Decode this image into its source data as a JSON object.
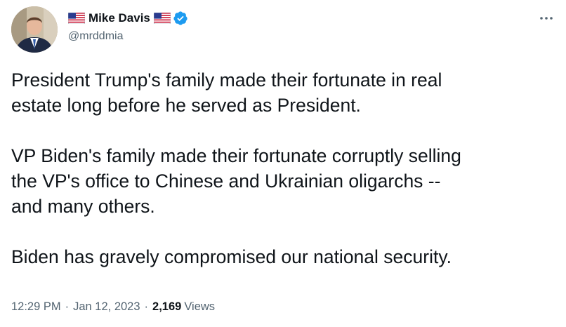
{
  "author": {
    "display_name": "Mike Davis",
    "handle": "@mrddmia",
    "verified": true,
    "name_emoji": "us-flag-icon"
  },
  "tweet": {
    "paragraphs": [
      "President Trump's family made their fortunate in real\nestate long before he served as President.",
      "VP Biden's family made their fortunate corruptly selling\nthe VP's office to Chinese and Ukrainian oligarchs --\nand many others.",
      "Biden has gravely compromised our national security."
    ],
    "time": "12:29 PM",
    "separator": "·",
    "date": "Jan 12, 2023",
    "views_count": "2,169",
    "views_label": "Views"
  },
  "colors": {
    "text_primary": "#0f1419",
    "text_secondary": "#536471",
    "verified_blue": "#1d9bf0"
  }
}
